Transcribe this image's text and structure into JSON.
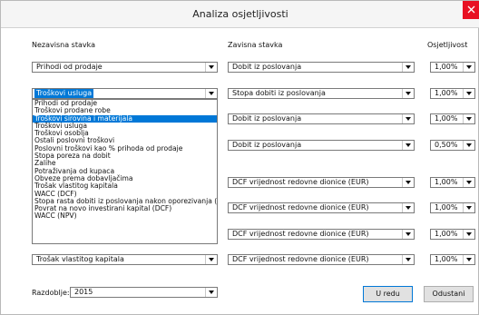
{
  "window": {
    "title": "Analiza osjetljivosti"
  },
  "headers": {
    "independent": "Nezavisna stavka",
    "dependent": "Zavisna stavka",
    "sensitivity": "Osjetljivost"
  },
  "rows": [
    {
      "independent": "Prihodi od prodaje",
      "dependent": "Dobit iz poslovanja",
      "sensitivity": "1,00%"
    },
    {
      "independent": "Troškovi usluga",
      "dependent": "Stopa dobiti iz poslovanja",
      "sensitivity": "1,00%"
    },
    {
      "independent": "",
      "dependent": "Dobit iz poslovanja",
      "sensitivity": "1,00%"
    },
    {
      "independent": "",
      "dependent": "Dobit iz poslovanja",
      "sensitivity": "0,50%"
    },
    {
      "independent": "",
      "dependent": "DCF vrijednost redovne dionice (EUR)",
      "sensitivity": "1,00%"
    },
    {
      "independent": "",
      "dependent": "DCF vrijednost redovne dionice (EUR)",
      "sensitivity": "1,00%"
    },
    {
      "independent": "",
      "dependent": "DCF vrijednost redovne dionice (EUR)",
      "sensitivity": "1,00%"
    },
    {
      "independent": "Trošak vlastitog kapitala",
      "dependent": "DCF vrijednost redovne dionice (EUR)",
      "sensitivity": "1,00%"
    }
  ],
  "dropdown_list": {
    "items": [
      "Prihodi od prodaje",
      "Troškovi prodane robe",
      "Troškovi sirovina i materijala",
      "Troškovi usluga",
      "Troškovi osoblja",
      "Ostali poslovni troškovi",
      "Poslovni troškovi kao % prihoda od prodaje",
      "Stopa poreza na dobit",
      "Zalihe",
      "Potraživanja od kupaca",
      "Obveze prema dobavljačima",
      "Trošak vlastitog kapitala",
      "WACC (DCF)",
      "Stopa rasta dobiti iz poslovanja nakon oporezivanja (DCF)",
      "Povrat na novo investirani kapital (DCF)",
      "WACC (NPV)"
    ],
    "selected": "Troškovi sirovina i materijala"
  },
  "period": {
    "label": "Razdoblje:",
    "value": "2015"
  },
  "buttons": {
    "ok": "U redu",
    "cancel": "Odustani"
  },
  "colors": {
    "selection": "#0078d7",
    "close": "#e81123"
  }
}
